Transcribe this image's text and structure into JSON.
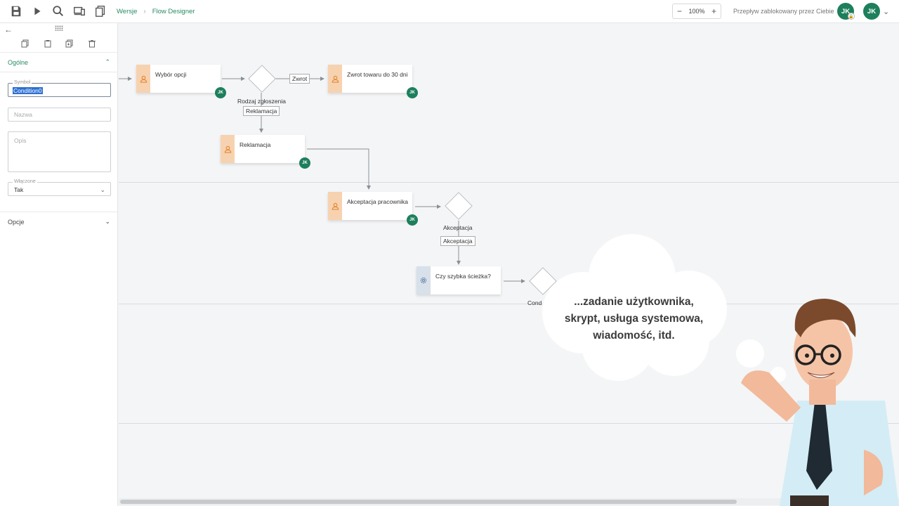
{
  "toolbar": {
    "breadcrumbs": [
      "Wersje",
      "Flow Designer"
    ],
    "zoom": "100%",
    "zoom_minus": "−",
    "zoom_plus": "+",
    "locked_text": "Przepływ zablokowany przez Ciebie",
    "user_initials": "JK"
  },
  "panel": {
    "section_general": "Ogólne",
    "symbol_label": "Symbol",
    "symbol_value": "Condition0",
    "name_placeholder": "Nazwa",
    "description_placeholder": "Opis",
    "enabled_label": "Włączone",
    "enabled_value": "Tak",
    "section_options": "Opcje"
  },
  "diagram": {
    "tasks": [
      {
        "name": "Wybór opcji",
        "type": "user",
        "assignee": "JK"
      },
      {
        "name": "Zwrot towaru do 30 dni",
        "type": "user",
        "assignee": "JK"
      },
      {
        "name": "Reklamacja",
        "type": "user",
        "assignee": "JK"
      },
      {
        "name": "Akceptacja pracownika",
        "type": "user",
        "assignee": "JK"
      },
      {
        "name": "Czy szybka ścieżka?",
        "type": "script",
        "assignee": ""
      }
    ],
    "gateways": [
      {
        "name": "Rodzaj zgłoszenia"
      },
      {
        "name": "Akceptacja"
      },
      {
        "name": "Cond"
      }
    ],
    "edge_labels": [
      "Zwrot",
      "Reklamacja",
      "Akceptacja"
    ]
  },
  "cloud": {
    "lines": [
      "...zadanie użytkownika,",
      "skrypt, usługa systemowa,",
      "wiadomość, itd."
    ]
  }
}
